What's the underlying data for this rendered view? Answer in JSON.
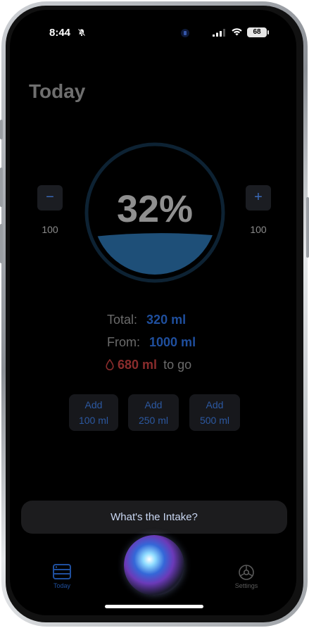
{
  "status_bar": {
    "time": "8:44",
    "battery": "68",
    "icons": [
      "bell-slash-icon",
      "island-icon",
      "cellular-signal-icon",
      "wifi-icon",
      "battery-icon"
    ]
  },
  "page": {
    "title": "Today"
  },
  "gauge": {
    "percent_text": "32%",
    "fill_fraction": 0.32,
    "accent": "#1e4f78"
  },
  "stepper": {
    "decrease_label": "−",
    "decrease_value": "100",
    "increase_label": "+",
    "increase_value": "100"
  },
  "stats": {
    "total_label": "Total:",
    "total_value": "320 ml",
    "from_label": "From:",
    "from_value": "1000 ml",
    "remaining_value": "680 ml",
    "remaining_suffix": "to go"
  },
  "quick_add": [
    {
      "line1": "Add",
      "line2": "100 ml"
    },
    {
      "line1": "Add",
      "line2": "250 ml"
    },
    {
      "line1": "Add",
      "line2": "500 ml"
    }
  ],
  "siri": {
    "suggestion": "What's the Intake?"
  },
  "tabbar": {
    "today_label": "Today",
    "settings_label": "Settings"
  },
  "colors": {
    "blue": "#1f4f9e",
    "red": "#8a2c2c",
    "background": "#000000"
  }
}
